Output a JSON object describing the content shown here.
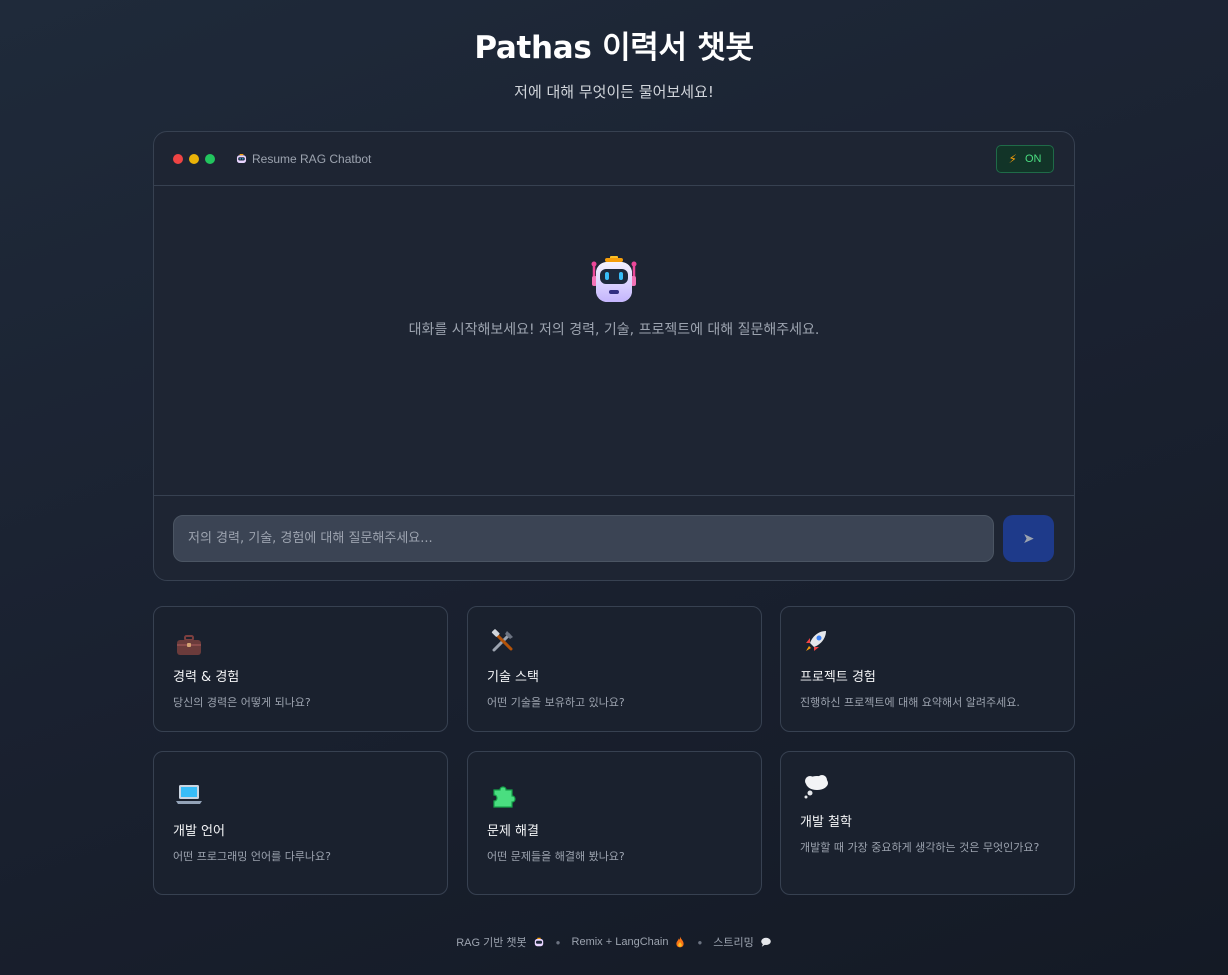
{
  "header": {
    "title": "Pathas 이력서 챗봇",
    "subtitle": "저에 대해 무엇이든 물어보세요!"
  },
  "chat": {
    "window_title": "Resume RAG Chatbot",
    "status_label": "ON",
    "empty_message": "대화를 시작해보세요! 저의 경력, 기술, 프로젝트에 대해 질문해주세요.",
    "input_placeholder": "저의 경력, 기술, 경험에 대해 질문해주세요...",
    "input_value": "",
    "send_label": "➤"
  },
  "cards": [
    {
      "icon": "briefcase-icon",
      "title": "경력 & 경험",
      "desc": "당신의 경력은 어떻게 되나요?"
    },
    {
      "icon": "tools-icon",
      "title": "기술 스택",
      "desc": "어떤 기술을 보유하고 있나요?"
    },
    {
      "icon": "rocket-icon",
      "title": "프로젝트 경험",
      "desc": "진행하신 프로젝트에 대해 요약해서 알려주세요."
    },
    {
      "icon": "laptop-icon",
      "title": "개발 언어",
      "desc": "어떤 프로그래밍 언어를 다루나요?"
    },
    {
      "icon": "puzzle-icon",
      "title": "문제 해결",
      "desc": "어떤 문제들을 해결해 봤나요?"
    },
    {
      "icon": "thought-bubble-icon",
      "title": "개발 철학",
      "desc": "개발할 때 가장 중요하게 생각하는 것은 무엇인가요?"
    }
  ],
  "footer": {
    "item1": "RAG 기반 챗봇",
    "item2": "Remix + LangChain",
    "item3": "스트리밍"
  },
  "colors": {
    "background": "#1a2130",
    "panel": "#1e2533",
    "accent": "#1e3a8a",
    "status_green": "#4ade80"
  }
}
